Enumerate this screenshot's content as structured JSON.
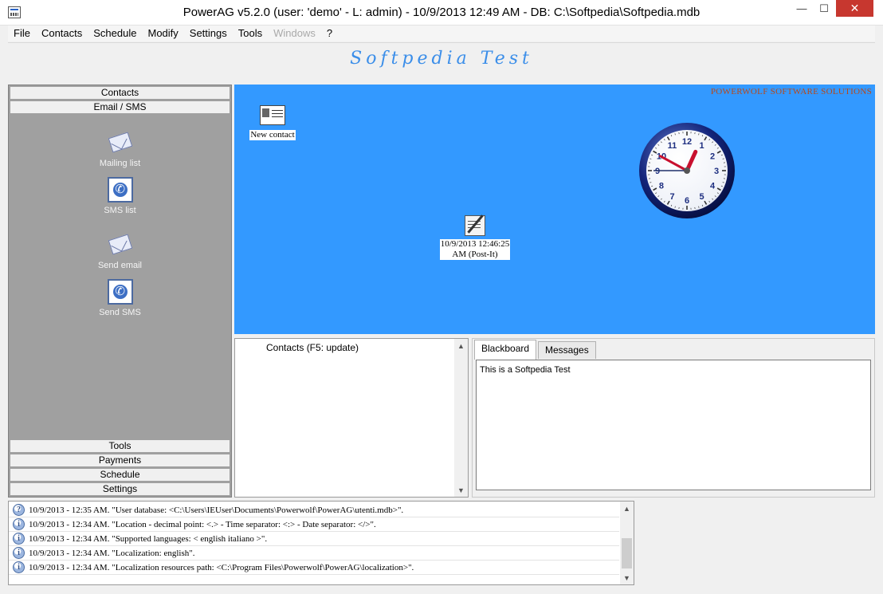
{
  "window": {
    "title": "PowerAG v5.2.0  (user: 'demo'  - L: admin) - 10/9/2013 12:49 AM - DB: C:\\Softpedia\\Softpedia.mdb",
    "min_glyph": "—",
    "max_glyph": "☐",
    "close_glyph": "✕"
  },
  "menu": [
    {
      "label": "File",
      "enabled": true
    },
    {
      "label": "Contacts",
      "enabled": true
    },
    {
      "label": "Schedule",
      "enabled": true
    },
    {
      "label": "Modify",
      "enabled": true
    },
    {
      "label": "Settings",
      "enabled": true
    },
    {
      "label": "Tools",
      "enabled": true
    },
    {
      "label": "Windows",
      "enabled": false
    },
    {
      "label": "?",
      "enabled": true
    }
  ],
  "banner": {
    "title": "Softpedia Test"
  },
  "sidebar": {
    "top_sections": [
      "Contacts",
      "Email / SMS"
    ],
    "items": [
      {
        "label": "Mailing list",
        "icon": "envelope-icon"
      },
      {
        "label": "SMS list",
        "icon": "phone-icon"
      },
      {
        "label": "Send email",
        "icon": "envelope-icon"
      },
      {
        "label": "Send SMS",
        "icon": "phone-icon"
      }
    ],
    "bottom_sections": [
      "Tools",
      "Payments",
      "Schedule",
      "Settings"
    ]
  },
  "desktop": {
    "brand": "POWERWOLF SOFTWARE SOLUTIONS",
    "new_contact_label": "New contact",
    "postit_label_line1": "10/9/2013 12:46:25",
    "postit_label_line2": "AM (Post-It)",
    "clock": {
      "hour": 12,
      "minute": 49,
      "second": 45,
      "numbers": [
        "1",
        "2",
        "3",
        "4",
        "5",
        "6",
        "7",
        "8",
        "9",
        "10",
        "11",
        "12"
      ]
    }
  },
  "contacts_panel": {
    "header": "Contacts  (F5: update)"
  },
  "tabs": {
    "items": [
      "Blackboard",
      "Messages"
    ],
    "active": "Blackboard",
    "blackboard_text": "This is a Softpedia Test"
  },
  "log": [
    {
      "icon": "question-icon",
      "glyph": "?",
      "text": "10/9/2013 - 12:35 AM. \"User database: <C:\\Users\\IEUser\\Documents\\Powerwolf\\PowerAG\\utenti.mdb>\"."
    },
    {
      "icon": "info-icon",
      "glyph": "i",
      "text": "10/9/2013 - 12:34 AM. \"Location - decimal point: <.> - Time separator: <:> - Date separator: </>\"."
    },
    {
      "icon": "info-icon",
      "glyph": "i",
      "text": "10/9/2013 - 12:34 AM. \"Supported languages: < english italiano >\"."
    },
    {
      "icon": "info-icon",
      "glyph": "i",
      "text": "10/9/2013 - 12:34 AM. \"Localization: english\"."
    },
    {
      "icon": "info-icon",
      "glyph": "i",
      "text": "10/9/2013 - 12:34 AM. \"Localization resources path: <C:\\Program Files\\Powerwolf\\PowerAG\\localization>\"."
    }
  ],
  "colors": {
    "desktop_bg": "#3399ff",
    "banner_text": "#3b8ee9",
    "brand_text": "#b84818",
    "close_bg": "#c7372f"
  }
}
